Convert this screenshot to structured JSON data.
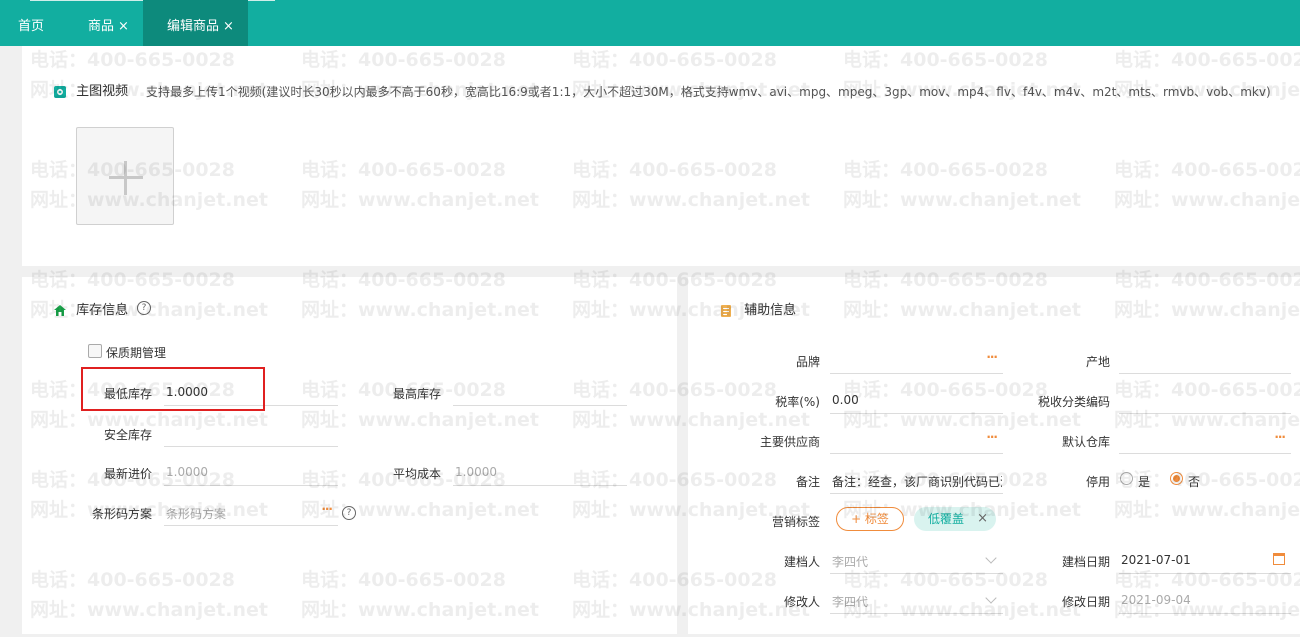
{
  "tabs": [
    {
      "label": "首页",
      "closable": false,
      "active": false
    },
    {
      "label": "商品",
      "closable": true,
      "active": false
    },
    {
      "label": "编辑商品",
      "closable": true,
      "active": true
    }
  ],
  "close_glyph": "×",
  "video": {
    "title": "主图视频",
    "hint": "支持最多上传1个视频(建议时长30秒以内最多不高于60秒，宽高比16:9或者1:1，大小不超过30M，格式支持wmv、avi、mpg、mpeg、3gp、mov、mp4、flv、f4v、m4v、m2t、mts、rmvb、vob、mkv)",
    "upload_icon": "plus-icon"
  },
  "stock": {
    "title": "库存信息",
    "help_glyph": "?",
    "shelf_life_label": "保质期管理",
    "min_stock_label": "最低库存",
    "min_stock_value": "1.0000",
    "max_stock_label": "最高库存",
    "max_stock_value": "",
    "safety_stock_label": "安全库存",
    "safety_stock_value": "",
    "latest_price_label": "最新进价",
    "latest_price_value": "1.0000",
    "avg_cost_label": "平均成本",
    "avg_cost_value": "1.0000",
    "barcode_label": "条形码方案",
    "barcode_placeholder": "条形码方案",
    "dots": "···"
  },
  "aux": {
    "title": "辅助信息",
    "brand_label": "品牌",
    "brand_value": "",
    "origin_label": "产地",
    "origin_value": "",
    "tax_rate_label": "税率(%)",
    "tax_rate_value": "0.00",
    "tax_code_label": "税收分类编码",
    "tax_code_value": "",
    "supplier_label": "主要供应商",
    "supplier_value": "",
    "warehouse_label": "默认仓库",
    "warehouse_value": "",
    "remark_label": "备注",
    "remark_value": "备注：经查，该厂商识别代码已注",
    "disabled_label": "停用",
    "radio_yes": "是",
    "radio_no": "否",
    "radio_selected": "否",
    "tags_label": "营销标签",
    "add_tag_label": "+ 标签",
    "tag_item": "低覆盖",
    "creator_label": "建档人",
    "creator_value": "李四代",
    "create_date_label": "建档日期",
    "create_date_value": "2021-07-01",
    "modifier_label": "修改人",
    "modifier_value": "李四代",
    "modify_date_label": "修改日期",
    "modify_date_value": "2021-09-04",
    "dots": "···"
  },
  "watermark": {
    "line1": "电话：400-665-0028",
    "line2": "网址：www.chanjet.net"
  },
  "colors": {
    "accent": "#12aea0",
    "accent_dark": "#0d8a7c",
    "orange": "#f08c3c",
    "highlight_red": "#e02020"
  }
}
